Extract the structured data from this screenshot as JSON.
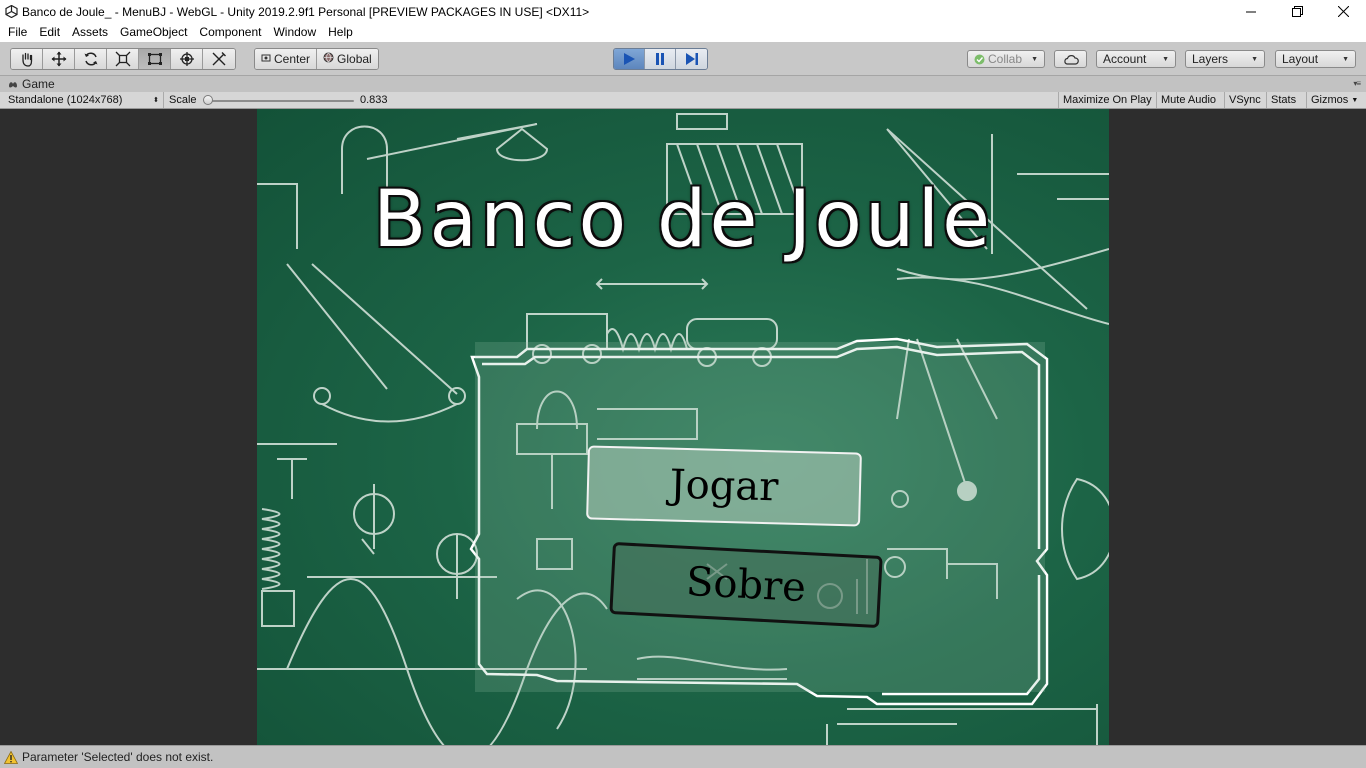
{
  "window": {
    "title": "Banco de Joule_ - MenuBJ - WebGL - Unity 2019.2.9f1 Personal [PREVIEW PACKAGES IN USE] <DX11>",
    "app_icon": "unity-icon",
    "controls": [
      "minimize-icon",
      "maximize-icon",
      "close-icon"
    ]
  },
  "menubar": {
    "items": [
      {
        "label": "File"
      },
      {
        "label": "Edit"
      },
      {
        "label": "Assets"
      },
      {
        "label": "GameObject"
      },
      {
        "label": "Component"
      },
      {
        "label": "Window"
      },
      {
        "label": "Help"
      }
    ]
  },
  "toolbar": {
    "tools": [
      "hand-tool-icon",
      "move-tool-icon",
      "rotate-tool-icon",
      "scale-tool-icon",
      "rect-tool-icon",
      "transform-tool-icon",
      "custom-tool-icon"
    ],
    "active_tool": "rect-tool-icon",
    "pivot_mode": "Center",
    "pivot_space": "Global",
    "play_active": true,
    "collab_label": "Collab",
    "account_label": "Account",
    "layers_label": "Layers",
    "layout_label": "Layout",
    "accent_color": "#5d86bd"
  },
  "game_tab": {
    "label": "Game"
  },
  "game_toolbar": {
    "resolution": "Standalone (1024x768)",
    "scale_label": "Scale",
    "scale_value": "0.833",
    "scale_fraction": 0.0,
    "toggles": [
      "Maximize On Play",
      "Mute Audio",
      "VSync",
      "Stats",
      "Gizmos"
    ]
  },
  "game": {
    "title": "Banco de Joule",
    "play_button": "Jogar",
    "about_button": "Sobre",
    "background_color": "#1c6446"
  },
  "status": {
    "message": "Parameter 'Selected' does not exist.",
    "icon": "warning-icon"
  }
}
